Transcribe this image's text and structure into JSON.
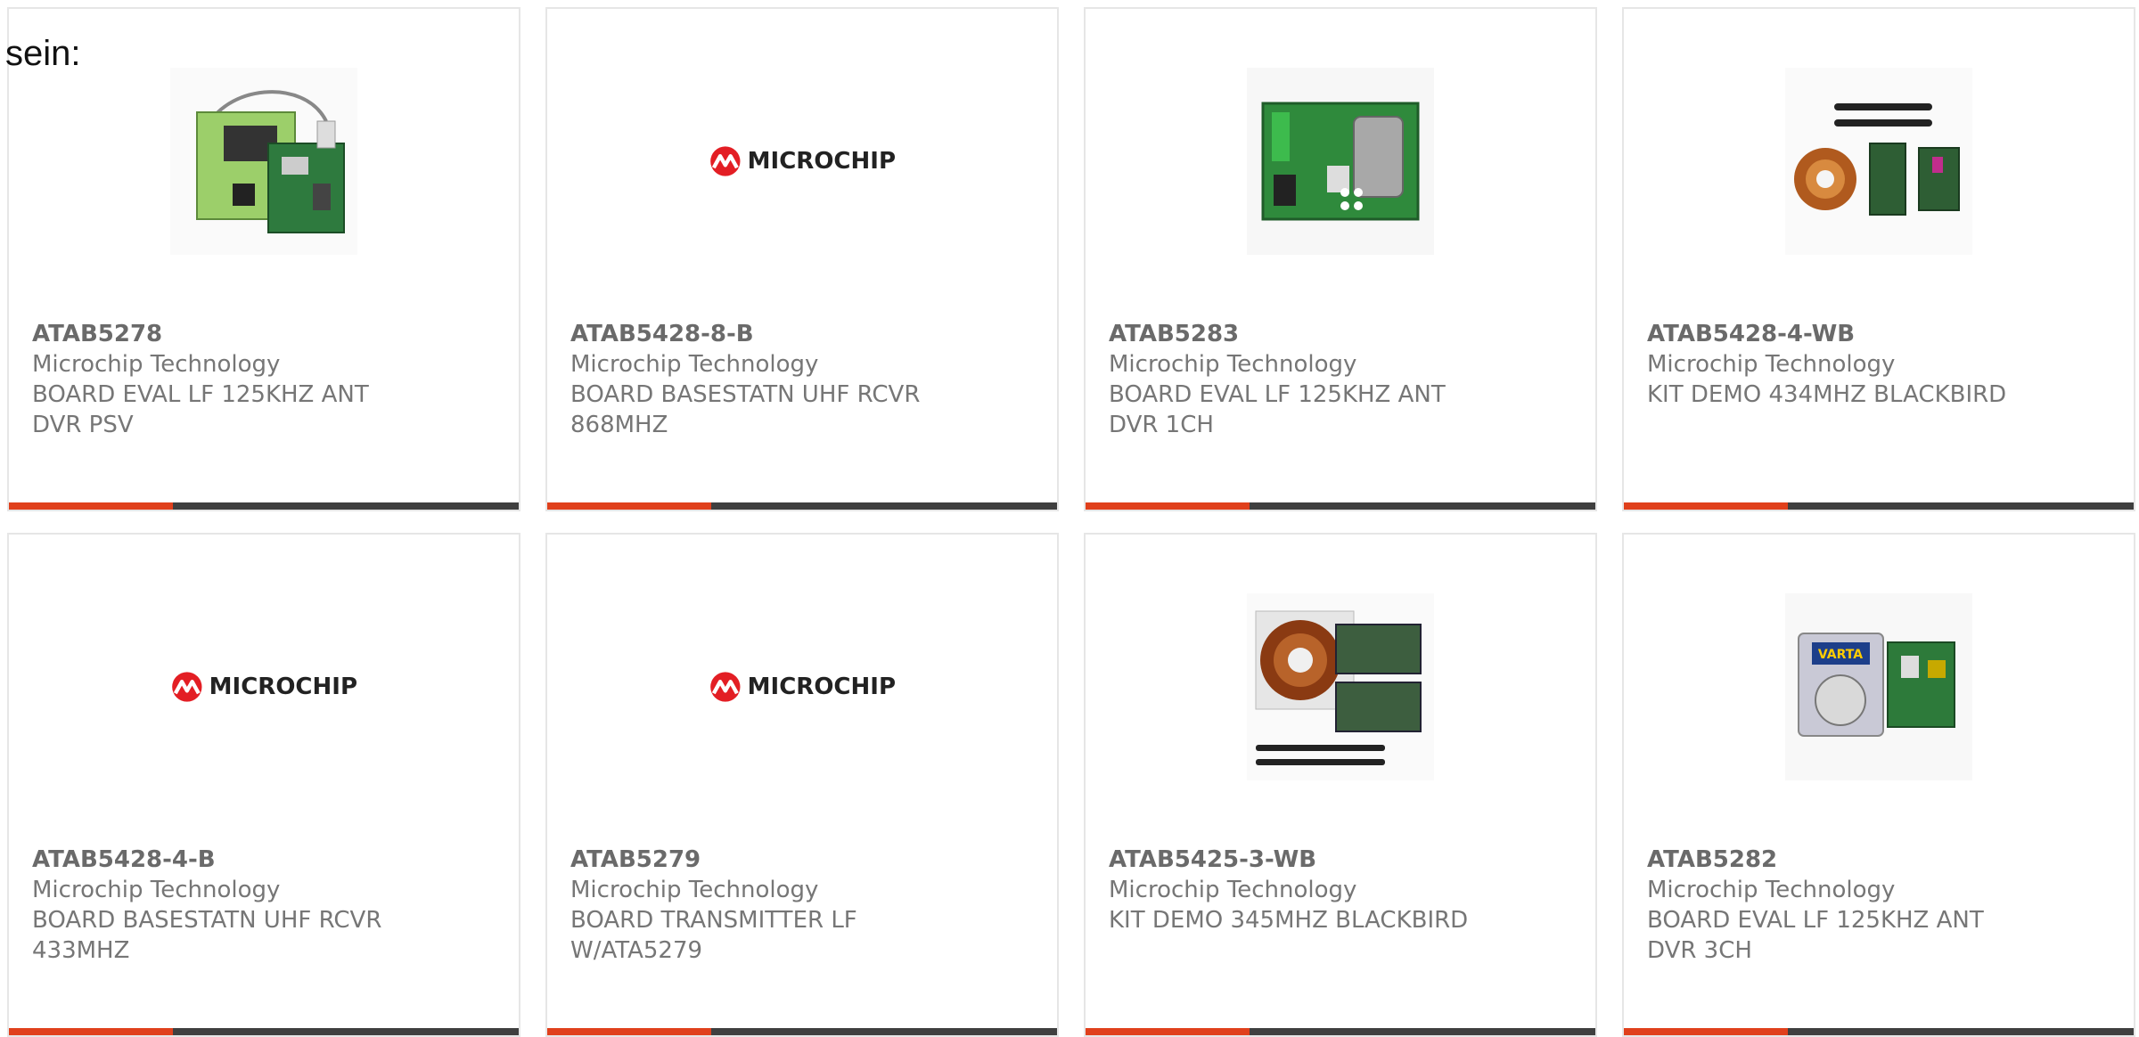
{
  "intro_text": "sein:",
  "accent_color": "#e0401c",
  "bar_color": "#3f3f3f",
  "products": [
    {
      "part": "ATAB5278",
      "maker": "Microchip Technology",
      "desc1": "BOARD EVAL LF 125KHZ ANT",
      "desc2": "DVR PSV",
      "image": "eval-board-photo"
    },
    {
      "part": "ATAB5428-8-B",
      "maker": "Microchip Technology",
      "desc1": "BOARD BASESTATN UHF RCVR",
      "desc2": "868MHZ",
      "image": "microchip-logo",
      "logo_text": "MICROCHIP"
    },
    {
      "part": "ATAB5283",
      "maker": "Microchip Technology",
      "desc1": "BOARD EVAL LF 125KHZ ANT",
      "desc2": "DVR 1CH",
      "image": "green-pcb-photo"
    },
    {
      "part": "ATAB5428-4-WB",
      "maker": "Microchip Technology",
      "desc1": "KIT DEMO 434MHZ BLACKBIRD",
      "desc2": "",
      "image": "demo-kit-photo"
    },
    {
      "part": "ATAB5428-4-B",
      "maker": "Microchip Technology",
      "desc1": "BOARD BASESTATN UHF RCVR",
      "desc2": "433MHZ",
      "image": "microchip-logo",
      "logo_text": "MICROCHIP"
    },
    {
      "part": "ATAB5279",
      "maker": "Microchip Technology",
      "desc1": "BOARD TRANSMITTER LF",
      "desc2": "W/ATA5279",
      "image": "microchip-logo",
      "logo_text": "MICROCHIP"
    },
    {
      "part": "ATAB5425-3-WB",
      "maker": "Microchip Technology",
      "desc1": "KIT DEMO 345MHZ BLACKBIRD",
      "desc2": "",
      "image": "demo-kit-coil-photo"
    },
    {
      "part": "ATAB5282",
      "maker": "Microchip Technology",
      "desc1": "BOARD EVAL LF 125KHZ ANT",
      "desc2": "DVR 3CH",
      "image": "battery-kit-photo",
      "battery_label": "VARTA"
    }
  ]
}
